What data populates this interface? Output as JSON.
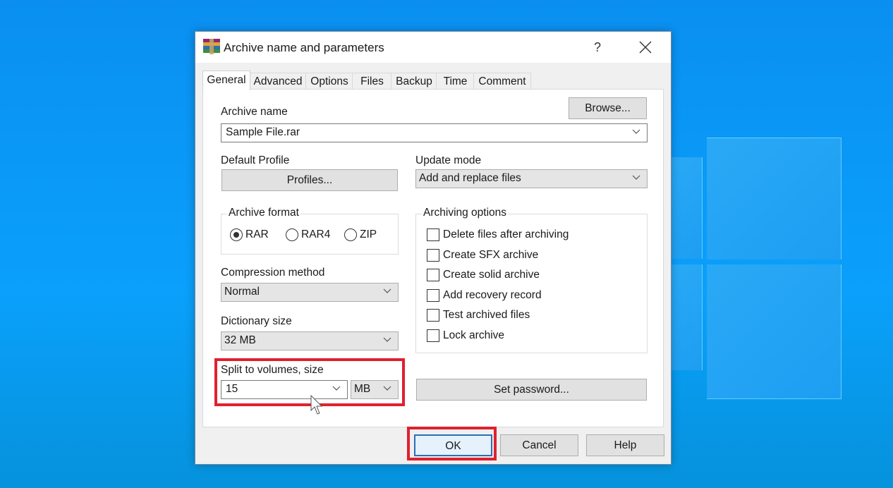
{
  "dialog": {
    "title": "Archive name and parameters",
    "help_label": "?",
    "close_icon": "close-icon",
    "app_icon": "winrar-books-icon"
  },
  "tabs": [
    {
      "label": "General",
      "active": true
    },
    {
      "label": "Advanced",
      "active": false
    },
    {
      "label": "Options",
      "active": false
    },
    {
      "label": "Files",
      "active": false
    },
    {
      "label": "Backup",
      "active": false
    },
    {
      "label": "Time",
      "active": false
    },
    {
      "label": "Comment",
      "active": false
    }
  ],
  "general": {
    "archive_name_label": "Archive name",
    "browse_label": "Browse...",
    "archive_name_value": "Sample File.rar",
    "default_profile_label": "Default Profile",
    "profiles_label": "Profiles...",
    "update_mode_label": "Update mode",
    "update_mode_value": "Add and replace files",
    "archive_format": {
      "title": "Archive format",
      "options": [
        "RAR",
        "RAR4",
        "ZIP"
      ],
      "selected": "RAR"
    },
    "compression_method_label": "Compression method",
    "compression_method_value": "Normal",
    "dictionary_size_label": "Dictionary size",
    "dictionary_size_value": "32 MB",
    "split_label": "Split to volumes, size",
    "split_value": "15",
    "split_unit": "MB",
    "archiving_options": {
      "title": "Archiving options",
      "items": [
        {
          "label": "Delete files after archiving",
          "checked": false
        },
        {
          "label": "Create SFX archive",
          "checked": false
        },
        {
          "label": "Create solid archive",
          "checked": false
        },
        {
          "label": "Add recovery record",
          "checked": false
        },
        {
          "label": "Test archived files",
          "checked": false
        },
        {
          "label": "Lock archive",
          "checked": false
        }
      ]
    },
    "set_password_label": "Set password..."
  },
  "footer": {
    "ok_label": "OK",
    "cancel_label": "Cancel",
    "help_label": "Help"
  },
  "colors": {
    "highlight": "#e0202e",
    "desktop": "#0a9cf5",
    "ok_focus_border": "#2a6ebb"
  }
}
